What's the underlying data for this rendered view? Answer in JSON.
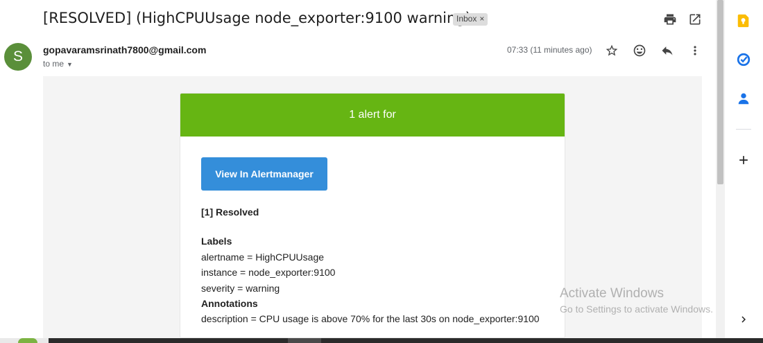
{
  "email": {
    "subject": "[RESOLVED] (HighCPUUsage node_exporter:9100 warning)",
    "label_chip": "Inbox",
    "label_chip_close": "×",
    "sender_initial": "S",
    "sender": "gopavaramsrinath7800@gmail.com",
    "to_me": "to me",
    "time": "07:33 (11 minutes ago)"
  },
  "toolbar_icons": [
    "print-icon",
    "open-in-new-window-icon",
    "star-icon",
    "emoji-icon",
    "reply-icon",
    "more-vert-icon"
  ],
  "alert": {
    "header": "1 alert for",
    "button_label": "View In Alertmanager",
    "resolved_title": "[1] Resolved",
    "labels_title": "Labels",
    "labels": [
      "alertname = HighCPUUsage",
      "instance = node_exporter:9100",
      "severity = warning"
    ],
    "annotations_title": "Annotations",
    "annotations": [
      "description = CPU usage is above 70% for the last 30s on node_exporter:9100"
    ],
    "header_color": "#66b513",
    "button_color": "#348eda"
  },
  "side_panel_icons": [
    "google-keep-icon",
    "google-tasks-icon",
    "google-contacts-icon",
    "add-icon",
    "chevron-right-icon"
  ],
  "watermark": {
    "line1": "Activate Windows",
    "line2": "Go to Settings to activate Windows."
  }
}
